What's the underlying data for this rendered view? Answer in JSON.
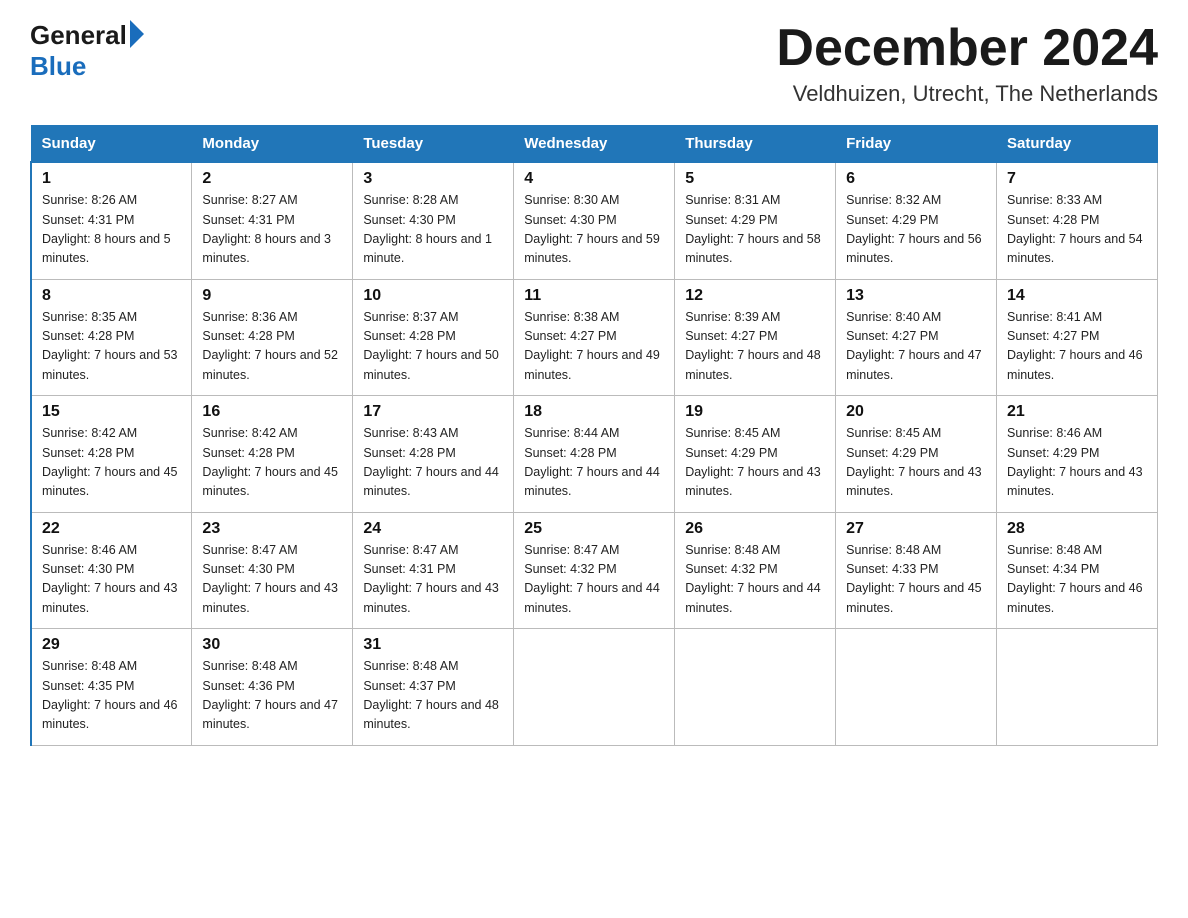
{
  "logo": {
    "general": "General",
    "blue": "Blue"
  },
  "header": {
    "month_year": "December 2024",
    "location": "Veldhuizen, Utrecht, The Netherlands"
  },
  "days_of_week": [
    "Sunday",
    "Monday",
    "Tuesday",
    "Wednesday",
    "Thursday",
    "Friday",
    "Saturday"
  ],
  "weeks": [
    [
      {
        "day": "1",
        "sunrise": "8:26 AM",
        "sunset": "4:31 PM",
        "daylight": "8 hours and 5 minutes."
      },
      {
        "day": "2",
        "sunrise": "8:27 AM",
        "sunset": "4:31 PM",
        "daylight": "8 hours and 3 minutes."
      },
      {
        "day": "3",
        "sunrise": "8:28 AM",
        "sunset": "4:30 PM",
        "daylight": "8 hours and 1 minute."
      },
      {
        "day": "4",
        "sunrise": "8:30 AM",
        "sunset": "4:30 PM",
        "daylight": "7 hours and 59 minutes."
      },
      {
        "day": "5",
        "sunrise": "8:31 AM",
        "sunset": "4:29 PM",
        "daylight": "7 hours and 58 minutes."
      },
      {
        "day": "6",
        "sunrise": "8:32 AM",
        "sunset": "4:29 PM",
        "daylight": "7 hours and 56 minutes."
      },
      {
        "day": "7",
        "sunrise": "8:33 AM",
        "sunset": "4:28 PM",
        "daylight": "7 hours and 54 minutes."
      }
    ],
    [
      {
        "day": "8",
        "sunrise": "8:35 AM",
        "sunset": "4:28 PM",
        "daylight": "7 hours and 53 minutes."
      },
      {
        "day": "9",
        "sunrise": "8:36 AM",
        "sunset": "4:28 PM",
        "daylight": "7 hours and 52 minutes."
      },
      {
        "day": "10",
        "sunrise": "8:37 AM",
        "sunset": "4:28 PM",
        "daylight": "7 hours and 50 minutes."
      },
      {
        "day": "11",
        "sunrise": "8:38 AM",
        "sunset": "4:27 PM",
        "daylight": "7 hours and 49 minutes."
      },
      {
        "day": "12",
        "sunrise": "8:39 AM",
        "sunset": "4:27 PM",
        "daylight": "7 hours and 48 minutes."
      },
      {
        "day": "13",
        "sunrise": "8:40 AM",
        "sunset": "4:27 PM",
        "daylight": "7 hours and 47 minutes."
      },
      {
        "day": "14",
        "sunrise": "8:41 AM",
        "sunset": "4:27 PM",
        "daylight": "7 hours and 46 minutes."
      }
    ],
    [
      {
        "day": "15",
        "sunrise": "8:42 AM",
        "sunset": "4:28 PM",
        "daylight": "7 hours and 45 minutes."
      },
      {
        "day": "16",
        "sunrise": "8:42 AM",
        "sunset": "4:28 PM",
        "daylight": "7 hours and 45 minutes."
      },
      {
        "day": "17",
        "sunrise": "8:43 AM",
        "sunset": "4:28 PM",
        "daylight": "7 hours and 44 minutes."
      },
      {
        "day": "18",
        "sunrise": "8:44 AM",
        "sunset": "4:28 PM",
        "daylight": "7 hours and 44 minutes."
      },
      {
        "day": "19",
        "sunrise": "8:45 AM",
        "sunset": "4:29 PM",
        "daylight": "7 hours and 43 minutes."
      },
      {
        "day": "20",
        "sunrise": "8:45 AM",
        "sunset": "4:29 PM",
        "daylight": "7 hours and 43 minutes."
      },
      {
        "day": "21",
        "sunrise": "8:46 AM",
        "sunset": "4:29 PM",
        "daylight": "7 hours and 43 minutes."
      }
    ],
    [
      {
        "day": "22",
        "sunrise": "8:46 AM",
        "sunset": "4:30 PM",
        "daylight": "7 hours and 43 minutes."
      },
      {
        "day": "23",
        "sunrise": "8:47 AM",
        "sunset": "4:30 PM",
        "daylight": "7 hours and 43 minutes."
      },
      {
        "day": "24",
        "sunrise": "8:47 AM",
        "sunset": "4:31 PM",
        "daylight": "7 hours and 43 minutes."
      },
      {
        "day": "25",
        "sunrise": "8:47 AM",
        "sunset": "4:32 PM",
        "daylight": "7 hours and 44 minutes."
      },
      {
        "day": "26",
        "sunrise": "8:48 AM",
        "sunset": "4:32 PM",
        "daylight": "7 hours and 44 minutes."
      },
      {
        "day": "27",
        "sunrise": "8:48 AM",
        "sunset": "4:33 PM",
        "daylight": "7 hours and 45 minutes."
      },
      {
        "day": "28",
        "sunrise": "8:48 AM",
        "sunset": "4:34 PM",
        "daylight": "7 hours and 46 minutes."
      }
    ],
    [
      {
        "day": "29",
        "sunrise": "8:48 AM",
        "sunset": "4:35 PM",
        "daylight": "7 hours and 46 minutes."
      },
      {
        "day": "30",
        "sunrise": "8:48 AM",
        "sunset": "4:36 PM",
        "daylight": "7 hours and 47 minutes."
      },
      {
        "day": "31",
        "sunrise": "8:48 AM",
        "sunset": "4:37 PM",
        "daylight": "7 hours and 48 minutes."
      },
      null,
      null,
      null,
      null
    ]
  ]
}
